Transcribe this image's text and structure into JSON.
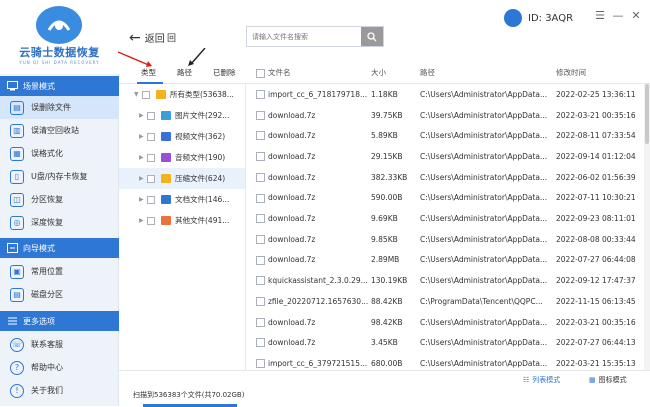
{
  "app": {
    "title": "云骑士数据恢复",
    "subtitle": "YUN QI SHI DATA RECOVERY"
  },
  "user": {
    "label": "ID: 3AQR"
  },
  "colors": {
    "accent": "#2f77d4",
    "sidebar_bg": "#eef3f9"
  },
  "sidebar": {
    "sections": [
      {
        "label": "场景模式",
        "icon": "monitor-icon",
        "items": [
          {
            "label": "误删除文件",
            "icon": "file-icon",
            "active": true
          },
          {
            "label": "误清空回收站",
            "icon": "trash-icon"
          },
          {
            "label": "误格式化",
            "icon": "format-icon"
          },
          {
            "label": "U盘/内存卡恢复",
            "icon": "usb-icon"
          },
          {
            "label": "分区恢复",
            "icon": "partition-icon"
          },
          {
            "label": "深度恢复",
            "icon": "deep-scan-icon"
          }
        ]
      },
      {
        "label": "向导模式",
        "icon": "guide-icon",
        "items": [
          {
            "label": "常用位置",
            "icon": "location-icon"
          },
          {
            "label": "磁盘分区",
            "icon": "disk-icon"
          }
        ]
      },
      {
        "label": "更多选项",
        "icon": "menu-icon",
        "items": [
          {
            "label": "联系客服",
            "icon": "support-icon"
          },
          {
            "label": "帮助中心",
            "icon": "help-icon"
          },
          {
            "label": "关于我们",
            "icon": "info-icon"
          }
        ]
      }
    ]
  },
  "toolbar": {
    "back_label": "返回",
    "home_label": "回",
    "search_placeholder": "请输入文件名搜索"
  },
  "tabs": [
    {
      "label": "类型"
    },
    {
      "label": "路径"
    },
    {
      "label": "已删除"
    }
  ],
  "tree": [
    {
      "label": "所有类型(53638...",
      "icon_color": "#f5b31b",
      "root": true
    },
    {
      "label": "图片文件(292...",
      "icon_color": "#3a9fd8"
    },
    {
      "label": "视频文件(362)",
      "icon_color": "#3a6fd8"
    },
    {
      "label": "音频文件(190)",
      "icon_color": "#9b4fd4"
    },
    {
      "label": "压缩文件(624)",
      "icon_color": "#f5b31b",
      "active": true
    },
    {
      "label": "文档文件(146...",
      "icon_color": "#2f77d4"
    },
    {
      "label": "其他文件(491...",
      "icon_color": "#e9733a"
    }
  ],
  "table": {
    "headers": {
      "name": "文件名",
      "size": "大小",
      "path": "路径",
      "modified": "修改时间"
    },
    "rows": [
      {
        "name": "import_cc_6_718179718...",
        "size": "1.18KB",
        "path": "C:\\Users\\Administrator\\AppData...",
        "modified": "2022-02-25 13:36:11"
      },
      {
        "name": "download.7z",
        "size": "39.75KB",
        "path": "C:\\Users\\Administrator\\AppData...",
        "modified": "2022-03-21 00:35:16"
      },
      {
        "name": "download.7z",
        "size": "5.89KB",
        "path": "C:\\Users\\Administrator\\AppData...",
        "modified": "2022-08-11 07:33:54"
      },
      {
        "name": "download.7z",
        "size": "29.15KB",
        "path": "C:\\Users\\Administrator\\AppData...",
        "modified": "2022-09-14 01:12:04"
      },
      {
        "name": "download.7z",
        "size": "382.33KB",
        "path": "C:\\Users\\Administrator\\AppData...",
        "modified": "2022-06-02 01:56:39"
      },
      {
        "name": "download.7z",
        "size": "590.00B",
        "path": "C:\\Users\\Administrator\\AppData...",
        "modified": "2022-07-11 10:30:21"
      },
      {
        "name": "download.7z",
        "size": "9.69KB",
        "path": "C:\\Users\\Administrator\\AppData...",
        "modified": "2022-09-23 08:11:01"
      },
      {
        "name": "download.7z",
        "size": "9.85KB",
        "path": "C:\\Users\\Administrator\\AppData...",
        "modified": "2022-08-08 00:33:44"
      },
      {
        "name": "download.7z",
        "size": "2.89MB",
        "path": "C:\\Users\\Administrator\\AppData...",
        "modified": "2022-07-27 06:44:08"
      },
      {
        "name": "kquickassistant_2.3.0.29...",
        "size": "130.19KB",
        "path": "C:\\Users\\Administrator\\AppData...",
        "modified": "2022-09-12 17:47:37"
      },
      {
        "name": "zfile_20220712.1657630...",
        "size": "88.42KB",
        "path": "C:\\ProgramData\\Tencent\\QQPC...",
        "modified": "2022-11-15 06:13:45"
      },
      {
        "name": "download.7z",
        "size": "98.42KB",
        "path": "C:\\Users\\Administrator\\AppData...",
        "modified": "2022-03-21 00:35:16"
      },
      {
        "name": "download.7z",
        "size": "3.45KB",
        "path": "C:\\Users\\Administrator\\AppData...",
        "modified": "2022-07-27 06:44:13"
      },
      {
        "name": "import_cc_6_379721515...",
        "size": "680.00B",
        "path": "C:\\Users\\Administrator\\AppData...",
        "modified": "2022-03-21 15:35:13"
      }
    ]
  },
  "status": {
    "text": "扫描到536383个文件(共70.02GB)"
  },
  "view": {
    "list_label": "列表模式",
    "grid_label": "图标模式"
  }
}
